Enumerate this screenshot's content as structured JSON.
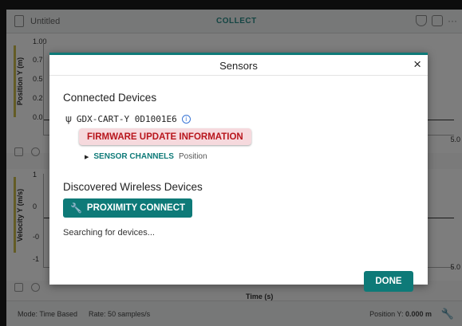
{
  "app": {
    "title": "Untitled",
    "collect_label": "COLLECT",
    "graph1": {
      "ylabel": "Position Y (m)",
      "ticks": [
        "1.00",
        "0.7",
        "0.5",
        "0.2",
        "0.0"
      ],
      "right_tick": "5.0"
    },
    "graph2": {
      "ylabel": "Velocity Y (m/s)",
      "ticks": [
        "1",
        "0",
        "-0",
        "-1"
      ],
      "right_tick": "5.0"
    },
    "xlabel": "Time (s)",
    "status": {
      "mode": "Mode: Time Based",
      "rate": "Rate: 50 samples/s",
      "position_label": "Position Y:",
      "position_value": "0.000 m"
    }
  },
  "modal": {
    "title": "Sensors",
    "close_glyph": "×",
    "connected_title": "Connected Devices",
    "device": {
      "usb_glyph": "ψ",
      "name": "GDX-CART-Y 0D1001E6",
      "info_glyph": "i"
    },
    "firmware_label": "FIRMWARE UPDATE INFORMATION",
    "channels": {
      "triangle": "▶",
      "label": "SENSOR CHANNELS",
      "value": "Position"
    },
    "discovered_title": "Discovered Wireless Devices",
    "proximity": {
      "icon_glyph": "🔧",
      "label": "PROXIMITY CONNECT"
    },
    "searching": "Searching for devices...",
    "done_label": "DONE"
  }
}
